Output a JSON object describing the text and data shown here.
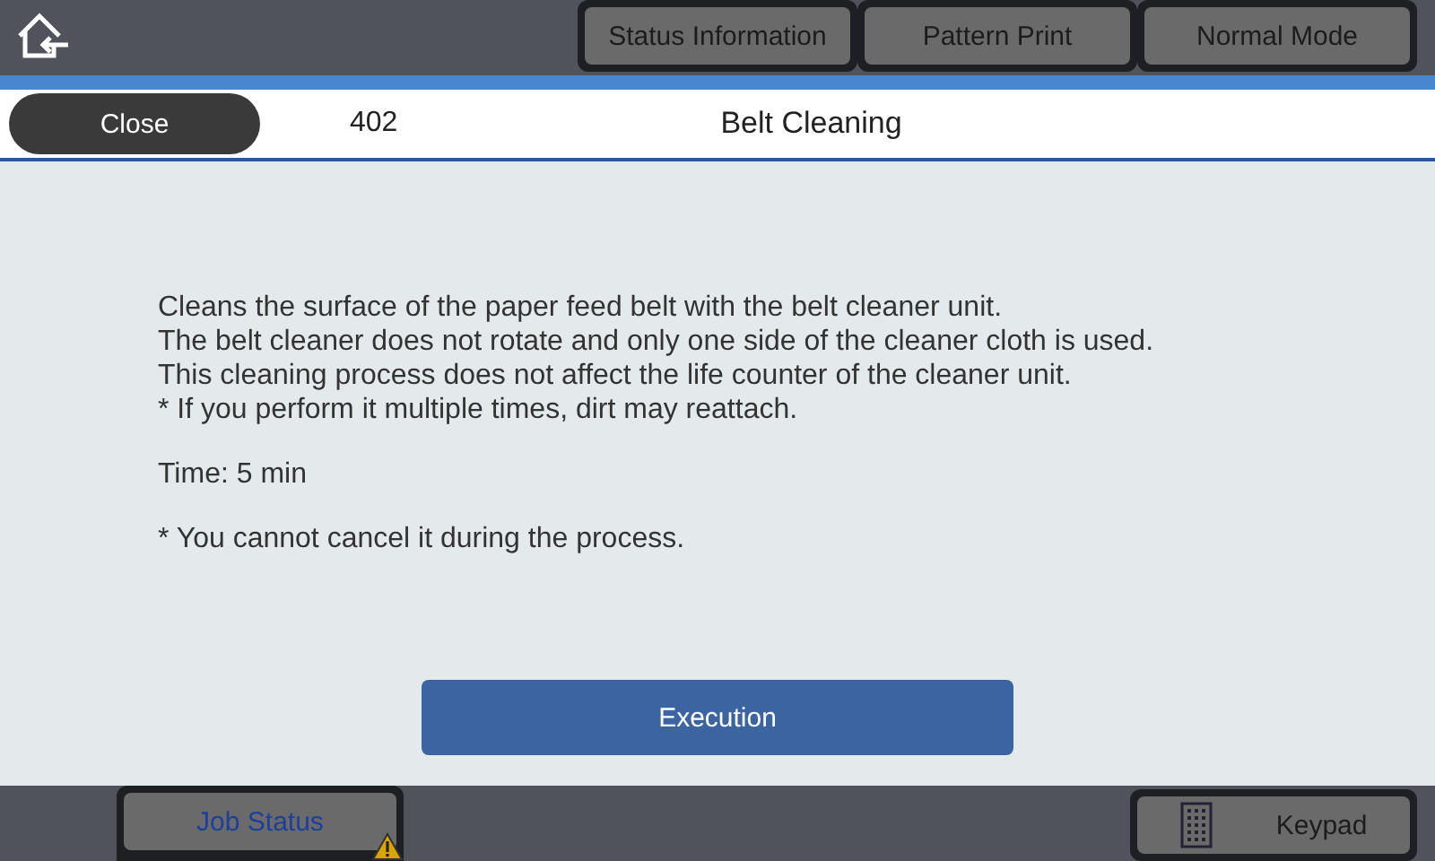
{
  "top_bar": {
    "buttons": [
      "Status Information",
      "Pattern Print",
      "Normal Mode"
    ]
  },
  "header": {
    "close": "Close",
    "number": "402",
    "title": "Belt Cleaning"
  },
  "description": [
    "Cleans the surface of the paper feed belt with the belt cleaner unit.",
    "The belt cleaner does not rotate and only one side of the cleaner cloth is used.",
    "This cleaning process does not affect the life counter of the cleaner unit.",
    "* If you perform it multiple times, dirt may reattach."
  ],
  "time": "Time: 5 min",
  "note": "* You cannot cancel it during the process.",
  "execute_button": "Execution",
  "bottom_bar": {
    "job_status": {
      "label": "Job Status",
      "warning": true
    },
    "keypad": "Keypad"
  }
}
